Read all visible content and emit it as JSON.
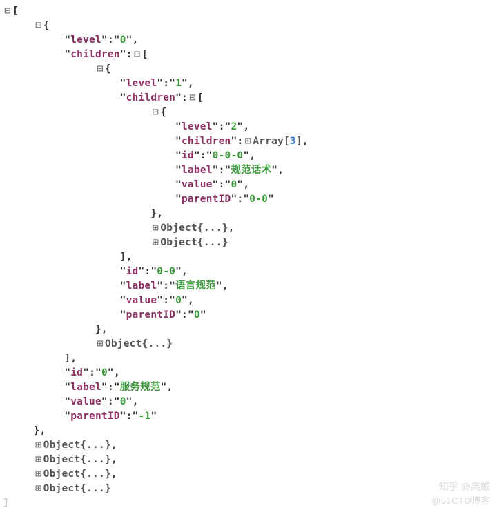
{
  "toggles": {
    "minus": "⊟",
    "plus": "⊞"
  },
  "punct": {
    "lbracket": "[",
    "rbracket": "]",
    "lbrace": "{",
    "rbrace": "}",
    "comma": ",",
    "colon": ":",
    "quote": "\""
  },
  "obj_collapsed": "Object{...}",
  "array_label_pre": "Array[",
  "array_label_suf": "]",
  "keys": {
    "level": "level",
    "children": "children",
    "id": "id",
    "label": "label",
    "value": "value",
    "parentID": "parentID"
  },
  "root": {
    "level": "0",
    "id": "0",
    "label": "服务规范",
    "value": "0",
    "parentID": "-1",
    "children_extra_count": 1
  },
  "child1": {
    "level": "1",
    "id": "0-0",
    "label": "语言规范",
    "value": "0",
    "parentID": "0",
    "children_extra_count": 2
  },
  "grand1": {
    "level": "2",
    "id": "0-0-0",
    "label": "规范话术",
    "value": "0",
    "parentID": "0-0",
    "children_array_len": "3"
  },
  "top_extra_siblings": 4,
  "watermark1": "知乎 @高威",
  "watermark2": "@51CTO博客"
}
